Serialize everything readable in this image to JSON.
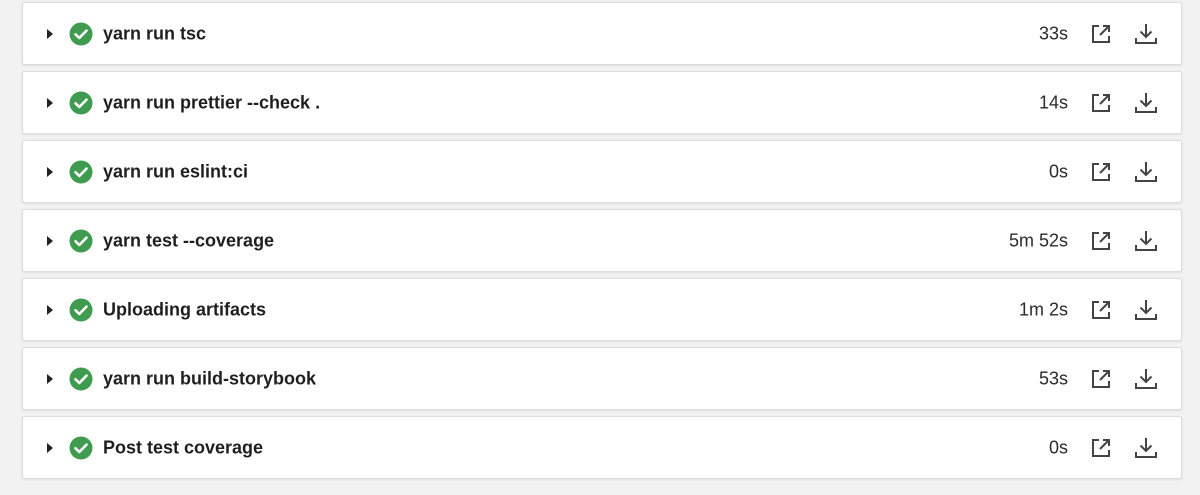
{
  "colors": {
    "success": "#3f9b4f",
    "icon_gray": "#444444"
  },
  "icons": {
    "toggle": "caret-right-icon",
    "status": "check-circle-icon",
    "open": "open-external-icon",
    "download": "download-icon"
  },
  "steps": [
    {
      "name": "yarn run tsc",
      "duration": "33s"
    },
    {
      "name": "yarn run prettier --check .",
      "duration": "14s"
    },
    {
      "name": "yarn run eslint:ci",
      "duration": "0s"
    },
    {
      "name": "yarn test --coverage",
      "duration": "5m 52s"
    },
    {
      "name": "Uploading artifacts",
      "duration": "1m 2s"
    },
    {
      "name": "yarn run build-storybook",
      "duration": "53s"
    },
    {
      "name": "Post test coverage",
      "duration": "0s"
    }
  ]
}
